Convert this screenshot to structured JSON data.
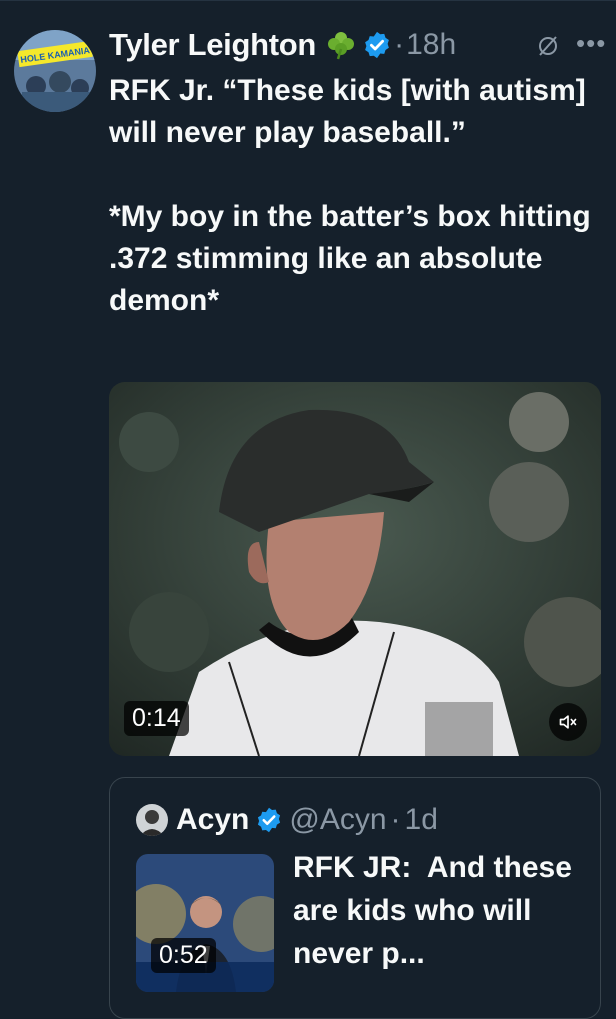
{
  "tweet": {
    "author_name": "Tyler Leighton",
    "emoji": "☘️",
    "separator": "·",
    "time": "18h",
    "avatar_banner_text": "HOLE KAMANIA",
    "text": "RFK Jr. “These kids [with autism] will never play baseball.”\n\n*My boy in the batter’s box hitting .372 stimming like an absolute demon*",
    "video": {
      "duration": "0:14"
    }
  },
  "quote": {
    "author_name": "Acyn",
    "handle": "@Acyn",
    "separator": "·",
    "time": "1d",
    "text": "RFK JR:  And these are kids who will never p...",
    "video": {
      "duration": "0:52"
    }
  },
  "icons": [
    "clover-icon",
    "verified-badge-icon",
    "grok-icon",
    "more-options-icon",
    "mute-icon"
  ],
  "colors": {
    "background": "#15202b",
    "verified": "#1d9bf0",
    "secondary_text": "#8b98a5",
    "border": "#38444d"
  }
}
